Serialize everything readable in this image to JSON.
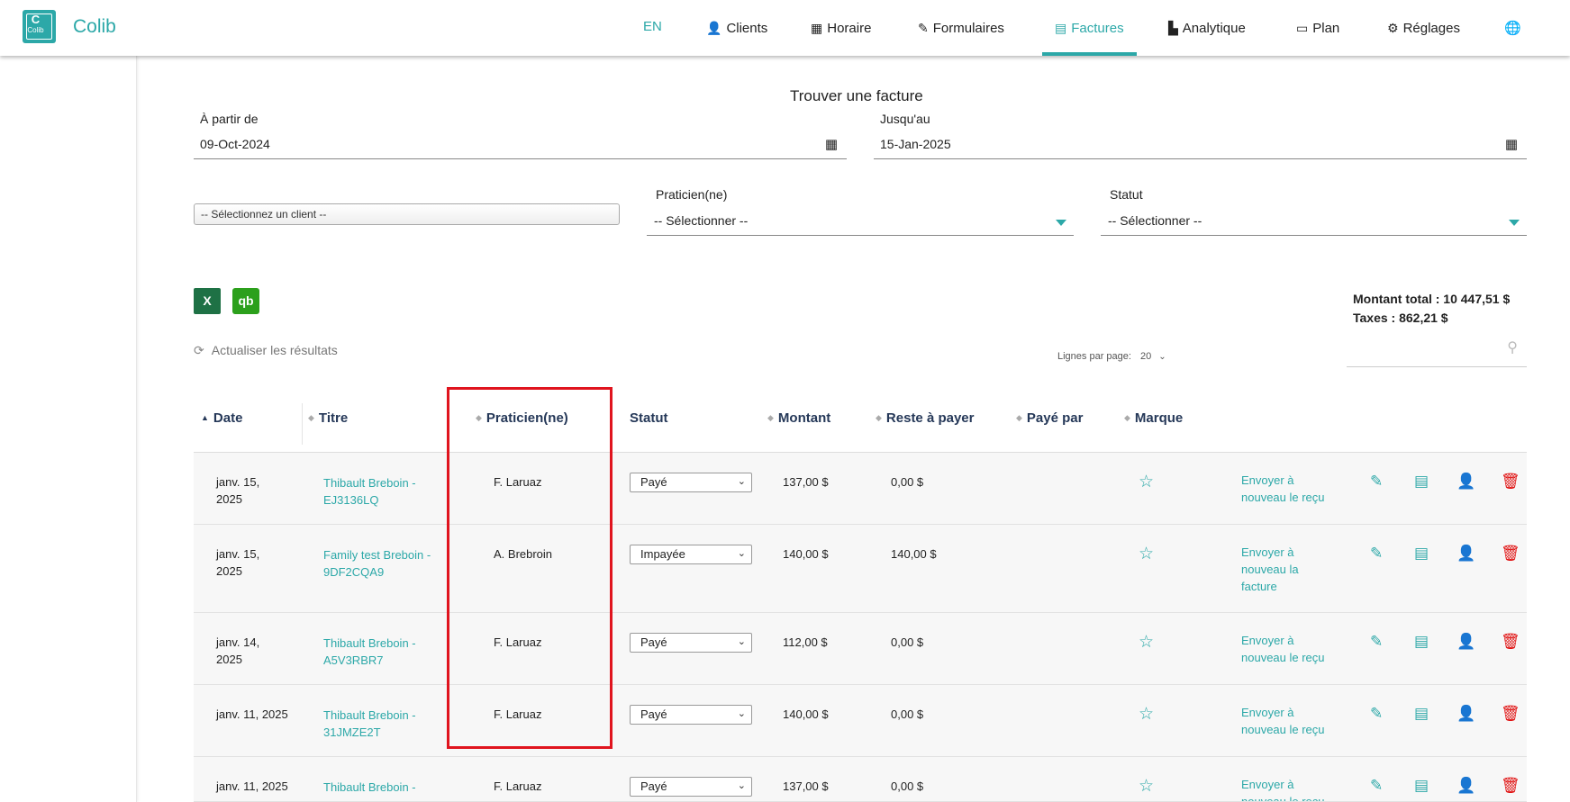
{
  "brand": {
    "name": "Colib",
    "logo_glyph": "C",
    "logo_text": "Colib",
    "color": "#2ca8a8"
  },
  "nav": {
    "lang": "EN",
    "items": [
      {
        "label": "Clients",
        "icon": "user-icon",
        "glyph": "👤"
      },
      {
        "label": "Horaire",
        "icon": "calendar-icon",
        "glyph": "▦"
      },
      {
        "label": "Formulaires",
        "icon": "form-edit-icon",
        "glyph": "✎"
      },
      {
        "label": "Factures",
        "icon": "invoice-icon",
        "glyph": "▤",
        "active": true
      },
      {
        "label": "Analytique",
        "icon": "chart-icon",
        "glyph": "▙"
      },
      {
        "label": "Plan",
        "icon": "credit-card-icon",
        "glyph": "▭"
      },
      {
        "label": "Réglages",
        "icon": "gear-icon",
        "glyph": "⚙"
      }
    ],
    "globe_glyph": "🌐"
  },
  "search_form": {
    "title": "Trouver une facture",
    "from_label": "À partir de",
    "from_value": "09-Oct-2024",
    "to_label": "Jusqu'au",
    "to_value": "15-Jan-2025",
    "client_placeholder": "-- Sélectionnez un client --",
    "practitioner_label": "Praticien(ne)",
    "practitioner_value": "-- Sélectionner --",
    "status_label": "Statut",
    "status_value": "-- Sélectionner --"
  },
  "toolbar": {
    "excel_glyph": "X",
    "quickbooks_glyph": "qb",
    "refresh_label": "Actualiser les résultats",
    "rows_per_page_label": "Lignes par page:",
    "rows_per_page_value": "20",
    "total_label": "Montant total : 10 447,51 $",
    "taxes_label": "Taxes : 862,21 $"
  },
  "table": {
    "headers": [
      "Date",
      "Titre",
      "Praticien(ne)",
      "Statut",
      "Montant",
      "Reste à payer",
      "Payé par",
      "Marque"
    ],
    "rows": [
      {
        "date": "janv. 15, 2025",
        "title": "Thibault Breboin - EJ3136LQ",
        "practitioner": "F. Laruaz",
        "status": "Payé",
        "amount": "137,00 $",
        "remaining": "0,00 $",
        "resend": "Envoyer à nouveau le reçu"
      },
      {
        "date": "janv. 15, 2025",
        "title": "Family test Breboin - 9DF2CQA9",
        "practitioner": "A. Brebroin",
        "status": "Impayée",
        "amount": "140,00 $",
        "remaining": "140,00 $",
        "resend": "Envoyer à nouveau la facture"
      },
      {
        "date": "janv. 14, 2025",
        "title": "Thibault Breboin - A5V3RBR7",
        "practitioner": "F. Laruaz",
        "status": "Payé",
        "amount": "112,00 $",
        "remaining": "0,00 $",
        "resend": "Envoyer à nouveau le reçu"
      },
      {
        "date": "janv. 11, 2025",
        "title": "Thibault Breboin - 31JMZE2T",
        "practitioner": "F. Laruaz",
        "status": "Payé",
        "amount": "140,00 $",
        "remaining": "0,00 $",
        "resend": "Envoyer à nouveau le reçu"
      },
      {
        "date": "janv. 11, 2025",
        "title": "Thibault Breboin - ",
        "practitioner": "F. Laruaz",
        "status": "Payé",
        "amount": "137,00 $",
        "remaining": "0,00 $",
        "resend": "Envoyer à nouveau le reçu"
      }
    ]
  }
}
